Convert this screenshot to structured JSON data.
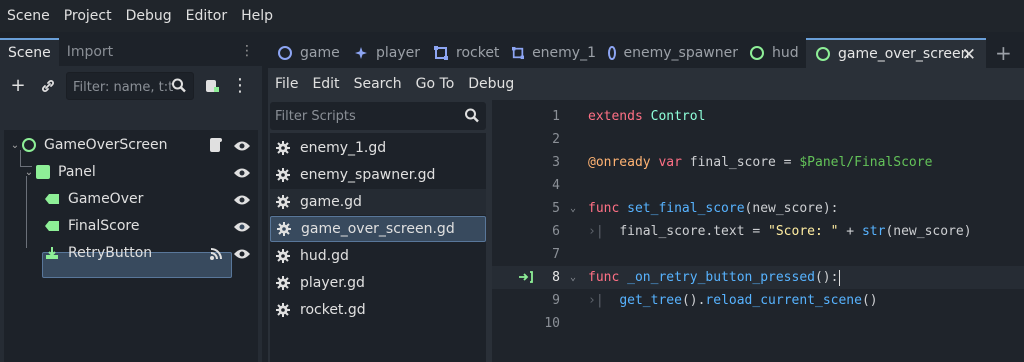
{
  "menubar": [
    "Scene",
    "Project",
    "Debug",
    "Editor",
    "Help"
  ],
  "dock": {
    "tabs": [
      "Scene",
      "Import"
    ],
    "filter_placeholder": "Filter: name, t:t",
    "tree": [
      {
        "label": "GameOverScreen"
      },
      {
        "label": "Panel"
      },
      {
        "label": "GameOver"
      },
      {
        "label": "FinalScore"
      },
      {
        "label": "RetryButton"
      }
    ]
  },
  "editor_tabs": [
    "game",
    "player",
    "rocket",
    "enemy_1",
    "enemy_spawner",
    "hud",
    "game_over_screen"
  ],
  "editor_menu": [
    "File",
    "Edit",
    "Search",
    "Go To",
    "Debug"
  ],
  "scripts": {
    "filter_placeholder": "Filter Scripts",
    "items": [
      "enemy_1.gd",
      "enemy_spawner.gd",
      "game.gd",
      "game_over_screen.gd",
      "hud.gd",
      "player.gd",
      "rocket.gd"
    ]
  },
  "code": {
    "line_numbers": [
      "1",
      "2",
      "3",
      "4",
      "5",
      "6",
      "7",
      "8",
      "9",
      "10"
    ],
    "l1_kw": "extends",
    "l1_type": "Control",
    "l3_annot": "@onready",
    "l3_kw": "var",
    "l3_mid": " final_score = ",
    "l3_node": "$Panel/FinalScore",
    "l5_kw": "func",
    "l5_fn": "set_final_score",
    "l5_rest": "(new_score):",
    "l6_a": "final_score.text = ",
    "l6_str": "\"Score: \"",
    "l6_b": " + ",
    "l6_fn": "str",
    "l6_c": "(new_score)",
    "l8_kw": "func",
    "l8_fn": "_on_retry_button_pressed",
    "l8_rest": "():",
    "l9_fn": "get_tree",
    "l9_a": "().",
    "l9_fn2": "reload_current_scene",
    "l9_b": "()"
  },
  "colors": {
    "accent": "#6a9fd8",
    "keyword": "#ff7085",
    "function": "#57b3ff",
    "string": "#ffeda1",
    "type": "#8effda",
    "node_path": "#63c259"
  }
}
